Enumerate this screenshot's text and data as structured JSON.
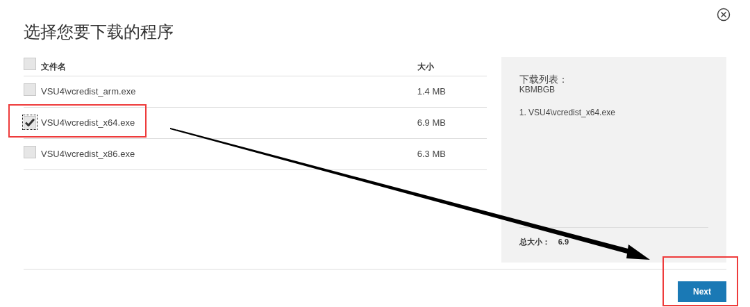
{
  "title": "选择您要下载的程序",
  "table": {
    "select_all": {
      "checked": false
    },
    "columns": [
      "文件名",
      "大小"
    ],
    "rows": [
      {
        "name": "VSU4\\vcredist_arm.exe",
        "size": "1.4 MB",
        "checked": false
      },
      {
        "name": "VSU4\\vcredist_x64.exe",
        "size": "6.9 MB",
        "checked": true
      },
      {
        "name": "VSU4\\vcredist_x86.exe",
        "size": "6.3 MB",
        "checked": false
      }
    ]
  },
  "summary": {
    "heading": "下载列表：",
    "subheading": "KBMBGB",
    "items": [
      "1. VSU4\\vcredist_x64.exe"
    ],
    "total_label": "总大小：",
    "total_value": "6.9"
  },
  "next_button": "Next"
}
